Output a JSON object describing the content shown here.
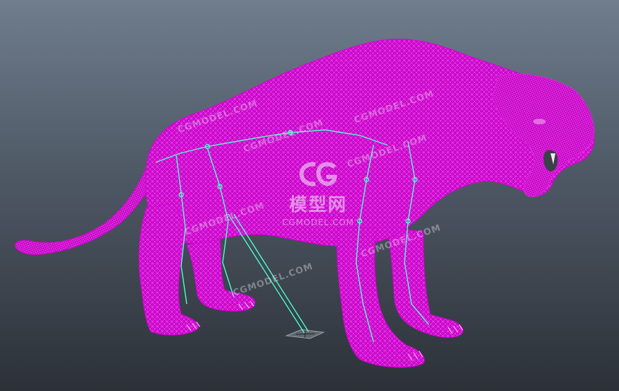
{
  "viewport": {
    "background_top": "#6f7d8d",
    "background_bottom": "#2c3138"
  },
  "model": {
    "wireframe_color": "#cc00cc",
    "wire_line_color": "#ff66ff",
    "joint_color": "#4dffd2"
  },
  "watermark": {
    "logo_icon": "cg-logo-icon",
    "cn_text": "模型网",
    "en_text": "CGMODEL.COM",
    "tile_text": "CGMODEL.COM"
  }
}
